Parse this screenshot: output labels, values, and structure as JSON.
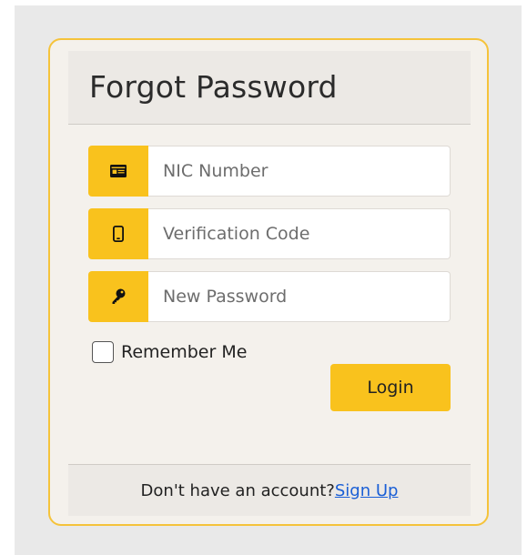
{
  "colors": {
    "accent": "#f9c21d",
    "card_border": "#f5c33b",
    "card_background": "#f4f1ec",
    "page_background": "#e9e9e9",
    "link": "#1a5fd6"
  },
  "header": {
    "title": "Forgot Password"
  },
  "form": {
    "fields": [
      {
        "icon": "id-card-icon",
        "placeholder": "NIC Number",
        "value": ""
      },
      {
        "icon": "mobile-phone-icon",
        "placeholder": "Verification Code",
        "value": ""
      },
      {
        "icon": "key-icon",
        "placeholder": "New Password",
        "value": ""
      }
    ],
    "remember_label": "Remember Me",
    "remember_checked": false,
    "submit_label": "Login"
  },
  "footer": {
    "prompt": "Don't have an account?",
    "link_label": "Sign Up"
  }
}
